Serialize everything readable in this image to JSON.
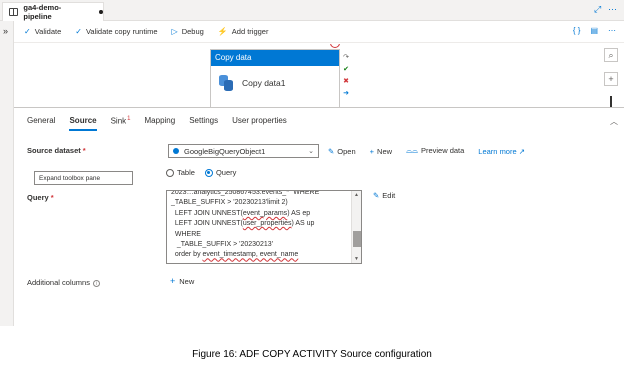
{
  "tab": {
    "title": "ga4-demo-pipeline"
  },
  "toolbar": {
    "validate": "Validate",
    "validate_copy": "Validate copy runtime",
    "debug": "Debug",
    "add_trigger": "Add trigger"
  },
  "canvas": {
    "activity_type": "Copy data",
    "activity_name": "Copy data1"
  },
  "props": {
    "tabs": [
      {
        "label": "General"
      },
      {
        "label": "Source"
      },
      {
        "label": "Sink",
        "badge": "1"
      },
      {
        "label": "Mapping"
      },
      {
        "label": "Settings"
      },
      {
        "label": "User properties"
      }
    ],
    "source_dataset_label": "Source dataset",
    "dataset_value": "GoogleBigQueryObject1",
    "open": "Open",
    "new": "New",
    "preview": "Preview data",
    "learn_more": "Learn more",
    "tooltip": "Expand toolbox pane",
    "use_query_table": "Table",
    "use_query_query": "Query",
    "query_label": "Query",
    "query_lines": [
      {
        "pre": "2023…analytics_250867453.events_*` WHERE"
      },
      {
        "pre": "_TABLE_SUFFIX > '20230213'limit 2)"
      },
      {
        "pre": "  LEFT JOIN UNNEST(",
        "err": "event_params",
        "post": ") AS ep"
      },
      {
        "pre": "  LEFT JOIN UNNEST(",
        "err": "user_properties",
        "post": ") AS up"
      },
      {
        "pre": "  WHERE"
      },
      {
        "pre": "   _TABLE_SUFFIX > '20230213'"
      },
      {
        "pre": "  order by ",
        "err": "event_timestamp, event_name",
        "post": ""
      }
    ],
    "edit": "Edit",
    "additional_columns": "Additional columns",
    "add_new": "New"
  },
  "caption": "Figure 16: ADF COPY ACTIVITY Source configuration"
}
